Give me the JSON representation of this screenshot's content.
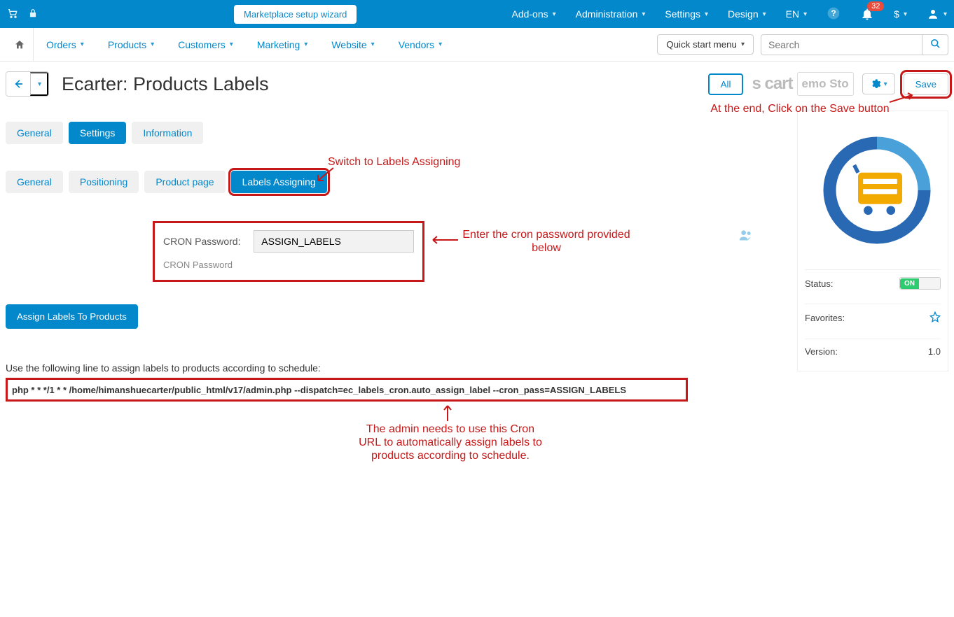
{
  "topbar": {
    "wizard_label": "Marketplace setup wizard",
    "links": [
      "Add-ons",
      "Administration",
      "Settings",
      "Design",
      "EN"
    ],
    "notif_count": "32",
    "currency_symbol": "$"
  },
  "navbar": {
    "items": [
      "Orders",
      "Products",
      "Customers",
      "Marketing",
      "Website",
      "Vendors"
    ],
    "quick_start": "Quick start menu",
    "search_placeholder": "Search"
  },
  "title": {
    "page_title": "Ecarter: Products Labels",
    "all_label": "All",
    "bg_text1": "s cart",
    "bg_text2": "emo Sto",
    "save_label": "Save"
  },
  "annotations": {
    "save_hint": "At the end, Click on the Save button",
    "switch_hint": "Switch to Labels Assigning",
    "cron_pass_hint": "Enter the cron   password provided below",
    "cron_url_hint": "The admin needs to use this Cron URL to automatically assign labels to products according to schedule."
  },
  "tabs": {
    "primary": [
      "General",
      "Settings",
      "Information"
    ],
    "primary_active": 1,
    "secondary": [
      "General",
      "Positioning",
      "Product page",
      "Labels Assigning"
    ],
    "secondary_active": 3
  },
  "form": {
    "cron_label": "CRON Password:",
    "cron_value": "ASSIGN_LABELS",
    "cron_hint": "CRON Password",
    "assign_btn": "Assign Labels To Products",
    "cron_help": "Use the following line to assign labels to products according to schedule:",
    "cron_line": "php * * */1 * * /home/himanshuecarter/public_html/v17/admin.php --dispatch=ec_labels_cron.auto_assign_label --cron_pass=ASSIGN_LABELS"
  },
  "sidebar": {
    "status_label": "Status:",
    "status_value": "ON",
    "favorites_label": "Favorites:",
    "version_label": "Version:",
    "version_value": "1.0"
  }
}
